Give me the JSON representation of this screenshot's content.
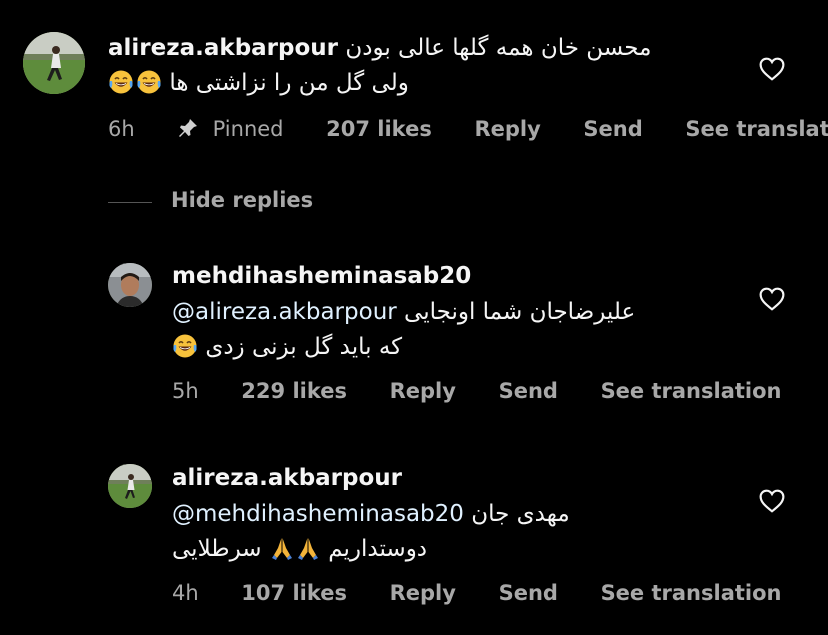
{
  "colors": {
    "background": "#000000",
    "text": "#f5f5f5",
    "secondary": "#a8a8a8",
    "mention": "#e0f1ff"
  },
  "comments": [
    {
      "username": "alireza.akbarpour",
      "text_line1": "محسن خان همه گلها عالی بودن",
      "text_line2": "ولی گل من را نزاشتی ها",
      "emoji_line2": [
        "face-with-tears-of-joy-icon",
        "face-with-tears-of-joy-icon"
      ],
      "time": "6h",
      "pinned_label": "Pinned",
      "likes": "207 likes",
      "reply": "Reply",
      "send": "Send",
      "see_translation": "See translati..."
    },
    {
      "username": "mehdihasheminasab20",
      "mention": "@alireza.akbarpour",
      "text_line1": "علیرضاجان شما اونجایی",
      "text_line2": "که باید گل بزنی زدی",
      "time": "5h",
      "likes": "229 likes",
      "reply": "Reply",
      "send": "Send",
      "see_translation": "See translation"
    },
    {
      "username": "alireza.akbarpour",
      "mention": "@mehdihasheminasab20",
      "text_line1": "مهدی جان",
      "text_line2_a": "دوستداریم",
      "text_line2_b": "سرطلایی",
      "time": "4h",
      "likes": "107 likes",
      "reply": "Reply",
      "send": "Send",
      "see_translation": "See translation"
    }
  ],
  "hide_replies": "Hide replies"
}
